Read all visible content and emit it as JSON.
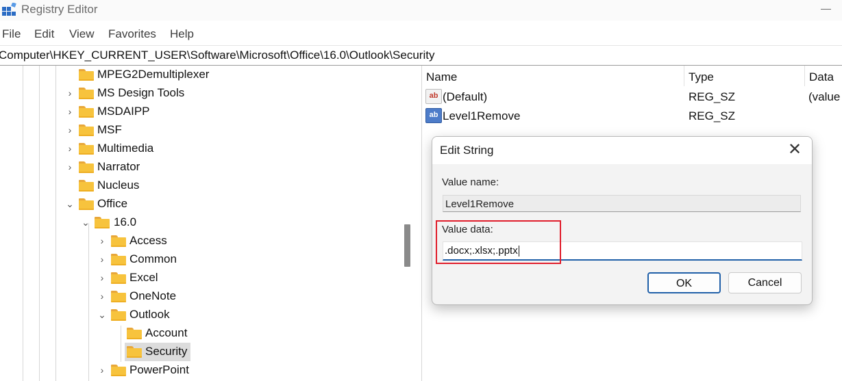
{
  "window": {
    "title": "Registry Editor"
  },
  "menu": [
    "File",
    "Edit",
    "View",
    "Favorites",
    "Help"
  ],
  "address": "Computer\\HKEY_CURRENT_USER\\Software\\Microsoft\\Office\\16.0\\Outlook\\Security",
  "tree": {
    "nodes": [
      {
        "label": "MPEG2Demultiplexer",
        "expander": ""
      },
      {
        "label": "MS Design Tools",
        "expander": "›"
      },
      {
        "label": "MSDAIPP",
        "expander": "›"
      },
      {
        "label": "MSF",
        "expander": "›"
      },
      {
        "label": "Multimedia",
        "expander": "›"
      },
      {
        "label": "Narrator",
        "expander": "›"
      },
      {
        "label": "Nucleus",
        "expander": ""
      },
      {
        "label": "Office",
        "expander": "⌄"
      },
      {
        "label": "16.0",
        "expander": "⌄"
      },
      {
        "label": "Access",
        "expander": "›"
      },
      {
        "label": "Common",
        "expander": "›"
      },
      {
        "label": "Excel",
        "expander": "›"
      },
      {
        "label": "OneNote",
        "expander": "›"
      },
      {
        "label": "Outlook",
        "expander": "⌄"
      },
      {
        "label": "Account",
        "expander": ""
      },
      {
        "label": "Security",
        "expander": "",
        "selected": true
      },
      {
        "label": "PowerPoint",
        "expander": "›"
      }
    ]
  },
  "list": {
    "columns": [
      "Name",
      "Type",
      "Data"
    ],
    "rows": [
      {
        "icon": "string-value-icon",
        "icon_glyph": "ab",
        "name": "(Default)",
        "type": "REG_SZ",
        "data": "(value"
      },
      {
        "icon": "binary-value-icon",
        "icon_glyph": "ab",
        "name": "Level1Remove",
        "type": "REG_SZ",
        "data": ""
      }
    ]
  },
  "dialog": {
    "title": "Edit String",
    "close_glyph": "✕",
    "value_name_label": "Value name:",
    "value_name": "Level1Remove",
    "value_data_label": "Value data:",
    "value_data": ".docx;.xlsx;.pptx",
    "ok_label": "OK",
    "cancel_label": "Cancel"
  },
  "colors": {
    "accent": "#1f5fa8",
    "highlight": "#e01d2b",
    "folder": "#f7c33d"
  }
}
